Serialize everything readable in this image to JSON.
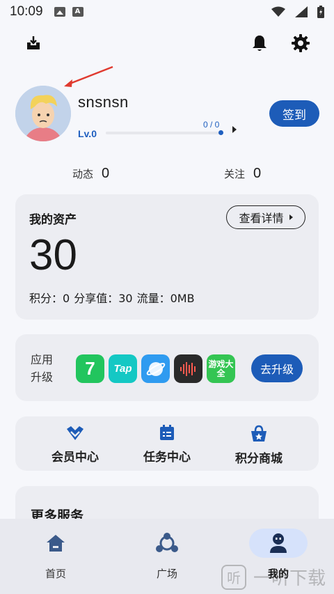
{
  "status_bar": {
    "time": "10:09"
  },
  "profile": {
    "username": "snsnsn",
    "level": "Lv.0",
    "xp_text": "0 / 0",
    "xp_progress": 1.0,
    "checkin_label": "签到"
  },
  "stats": [
    {
      "label": "动态",
      "value": "0"
    },
    {
      "label": "关注",
      "value": "0"
    }
  ],
  "assets": {
    "title": "我的资产",
    "details_label": "查看详情",
    "value": "30",
    "points_label": "积分：",
    "points_value": "0",
    "share_label": "分享值：",
    "share_value": "30",
    "traffic_label": "流量：",
    "traffic_value": "0MB"
  },
  "upgrade": {
    "label": "应用升级",
    "button": "去升级",
    "apps": [
      {
        "icon": "7-app-icon",
        "text": "7",
        "color": "#22c55e"
      },
      {
        "icon": "taptap-icon",
        "text": "Tap",
        "color": "#14c8c4"
      },
      {
        "icon": "browser-planet-icon",
        "text": "",
        "color": "#2f9bf0"
      },
      {
        "icon": "sound-recorder-icon",
        "text": "",
        "color": "#2a2a2a"
      },
      {
        "icon": "game-center-icon",
        "text": "游戏大全",
        "color": "#34c553"
      }
    ]
  },
  "quick_links": [
    {
      "label": "会员中心",
      "icon": "vip-icon"
    },
    {
      "label": "任务中心",
      "icon": "task-icon"
    },
    {
      "label": "积分商城",
      "icon": "shop-icon"
    }
  ],
  "services": {
    "title": "更多服务"
  },
  "nav": [
    {
      "label": "首页",
      "icon": "home-icon",
      "active": false
    },
    {
      "label": "广场",
      "icon": "square-icon",
      "active": false
    },
    {
      "label": "我的",
      "icon": "profile-icon",
      "active": true
    }
  ],
  "watermark": {
    "text": "一听下载"
  },
  "colors": {
    "accent": "#1d5cb8",
    "card": "#ecedf2",
    "annotation": "#e03a2f"
  }
}
